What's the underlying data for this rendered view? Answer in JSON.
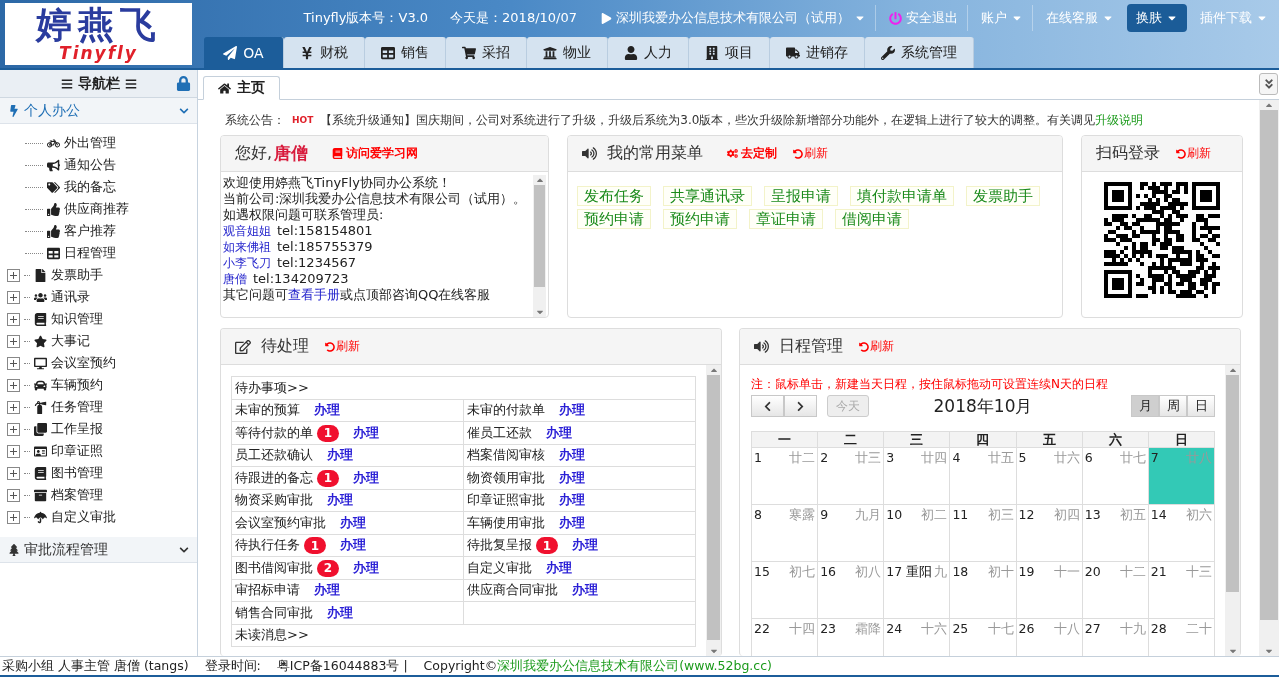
{
  "header": {
    "logo": {
      "title": "婷燕飞",
      "subtitle": "Tinyfly"
    },
    "version": "Tinyfly版本号：V3.0",
    "today": "今天是：2018/10/07",
    "company": "深圳我爱办公信息技术有限公司（试用）",
    "logout": "安全退出",
    "menus": [
      {
        "label": "账户",
        "selected": false
      },
      {
        "label": "在线客服",
        "selected": false
      },
      {
        "label": "换肤",
        "selected": true
      },
      {
        "label": "插件下载",
        "selected": false
      }
    ],
    "module_tabs": [
      {
        "label": "OA",
        "selected": true
      },
      {
        "label": "财税",
        "selected": false
      },
      {
        "label": "销售",
        "selected": false
      },
      {
        "label": "采招",
        "selected": false
      },
      {
        "label": "物业",
        "selected": false
      },
      {
        "label": "人力",
        "selected": false
      },
      {
        "label": "项目",
        "selected": false
      },
      {
        "label": "进销存",
        "selected": false
      },
      {
        "label": "系统管理",
        "selected": false
      }
    ]
  },
  "sidebar": {
    "title": "导航栏",
    "sections": [
      {
        "label": "个人办公",
        "expanded": true,
        "items": [
          {
            "label": "外出管理",
            "kind": "leaf"
          },
          {
            "label": "通知公告",
            "kind": "leaf"
          },
          {
            "label": "我的备忘",
            "kind": "leaf"
          },
          {
            "label": "供应商推荐",
            "kind": "leaf"
          },
          {
            "label": "客户推荐",
            "kind": "leaf"
          },
          {
            "label": "日程管理",
            "kind": "leaf"
          },
          {
            "label": "发票助手",
            "kind": "folder"
          },
          {
            "label": "通讯录",
            "kind": "folder"
          },
          {
            "label": "知识管理",
            "kind": "folder"
          },
          {
            "label": "大事记",
            "kind": "folder"
          },
          {
            "label": "会议室预约",
            "kind": "folder"
          },
          {
            "label": "车辆预约",
            "kind": "folder"
          },
          {
            "label": "任务管理",
            "kind": "folder"
          },
          {
            "label": "工作呈报",
            "kind": "folder"
          },
          {
            "label": "印章证照",
            "kind": "folder"
          },
          {
            "label": "图书管理",
            "kind": "folder"
          },
          {
            "label": "档案管理",
            "kind": "folder"
          },
          {
            "label": "自定义审批",
            "kind": "folder"
          }
        ]
      },
      {
        "label": "审批流程管理",
        "expanded": false
      }
    ]
  },
  "page_tabs": [
    {
      "label": "主页",
      "selected": true
    }
  ],
  "notice": {
    "label": "系统公告：",
    "badge": "HOT",
    "text": "【系统升级通知】国庆期间，公司对系统进行了升级，升级后系统为3.0版本，些次升级除新增部分功能外，在逻辑上进行了较大的调整。有关调见",
    "link": "升级说明"
  },
  "welcome": {
    "greeting": "您好,",
    "name": "唐僧",
    "link": "访问爱学习网",
    "lines": [
      "欢迎使用婷燕飞TinyFly协同办公系统！",
      "当前公司:深圳我爱办公信息技术有限公司（试用）。",
      "如遇权限问题可联系管理员:"
    ],
    "contacts": [
      {
        "name": "观音姐姐",
        "tel": "tel:158154801"
      },
      {
        "name": "如来佛祖",
        "tel": "tel:185755379"
      },
      {
        "name": "小李飞刀",
        "tel": "tel:1234567"
      },
      {
        "name": "唐僧",
        "tel": "tel:134209723"
      }
    ],
    "help": {
      "before": "其它问题可",
      "link": "查看手册",
      "after": "或点顶部咨询QQ在线客服"
    }
  },
  "menu_card": {
    "title": "我的常用菜单",
    "customize": "去定制",
    "refresh": "刷新",
    "items": [
      "发布任务",
      "共享通讯录",
      "呈报申请",
      "填付款申请单",
      "发票助手",
      "预约申请",
      "预约申请",
      "章证申请",
      "借阅申请"
    ]
  },
  "qr_card": {
    "title": "扫码登录",
    "refresh": "刷新"
  },
  "pending": {
    "title": "待处理",
    "refresh": "刷新",
    "sections": [
      {
        "title": "待办事项>>",
        "rows": [
          [
            {
              "label": "未审的预算",
              "action": "办理"
            },
            {
              "label": "未审的付款单",
              "action": "办理"
            }
          ],
          [
            {
              "label": "等待付款的单",
              "count": "1",
              "action": "办理"
            },
            {
              "label": "催员工还款",
              "action": "办理"
            }
          ],
          [
            {
              "label": "员工还款确认",
              "action": "办理"
            },
            {
              "label": "档案借阅审核",
              "action": "办理"
            }
          ],
          [
            {
              "label": "待跟进的备忘",
              "count": "1",
              "action": "办理"
            },
            {
              "label": "物资领用审批",
              "action": "办理"
            }
          ],
          [
            {
              "label": "物资采购审批",
              "action": "办理"
            },
            {
              "label": "印章证照审批",
              "action": "办理"
            }
          ],
          [
            {
              "label": "会议室预约审批",
              "action": "办理"
            },
            {
              "label": "车辆使用审批",
              "action": "办理"
            }
          ],
          [
            {
              "label": "待执行任务",
              "count": "1",
              "action": "办理"
            },
            {
              "label": "待批复呈报",
              "count": "1",
              "action": "办理"
            }
          ],
          [
            {
              "label": "图书借阅审批",
              "count": "2",
              "action": "办理"
            },
            {
              "label": "自定义审批",
              "action": "办理"
            }
          ],
          [
            {
              "label": "审招标申请",
              "action": "办理"
            },
            {
              "label": "供应商合同审批",
              "action": "办理"
            }
          ],
          [
            {
              "label": "销售合同审批",
              "action": "办理"
            },
            null
          ]
        ]
      },
      {
        "title": "未读消息>>"
      }
    ]
  },
  "schedule": {
    "title": "日程管理",
    "refresh": "刷新",
    "note": "注：鼠标单击，新建当天日程，按住鼠标拖动可设置连续N天的日程",
    "today_button": {
      "label": "今天",
      "disabled": true
    },
    "month": "2018年10月",
    "views": [
      {
        "label": "月",
        "selected": true
      },
      {
        "label": "周",
        "selected": false
      },
      {
        "label": "日",
        "selected": false
      }
    ],
    "weekdays": [
      "一",
      "二",
      "三",
      "四",
      "五",
      "六",
      "日"
    ],
    "weeks": [
      [
        {
          "day": "1",
          "lunar": "廿二",
          "today": false
        },
        {
          "day": "2",
          "lunar": "廿三",
          "today": false
        },
        {
          "day": "3",
          "lunar": "廿四",
          "today": false
        },
        {
          "day": "4",
          "lunar": "廿五",
          "today": false
        },
        {
          "day": "5",
          "lunar": "廿六",
          "today": false
        },
        {
          "day": "6",
          "lunar": "廿七",
          "today": false
        },
        {
          "day": "7",
          "lunar": "廿八",
          "today": true
        }
      ],
      [
        {
          "day": "8",
          "lunar": "寒露",
          "today": false
        },
        {
          "day": "9",
          "lunar": "九月",
          "today": false
        },
        {
          "day": "10",
          "lunar": "初二",
          "today": false
        },
        {
          "day": "11",
          "lunar": "初三",
          "today": false
        },
        {
          "day": "12",
          "lunar": "初四",
          "today": false
        },
        {
          "day": "13",
          "lunar": "初五",
          "today": false
        },
        {
          "day": "14",
          "lunar": "初六",
          "today": false
        }
      ],
      [
        {
          "day": "15",
          "lunar": "初七",
          "today": false
        },
        {
          "day": "16",
          "lunar": "初八",
          "today": false
        },
        {
          "day": "17",
          "festival": "重阳",
          "lunar": "九",
          "today": false
        },
        {
          "day": "18",
          "lunar": "初十",
          "today": false
        },
        {
          "day": "19",
          "lunar": "十一",
          "today": false
        },
        {
          "day": "20",
          "lunar": "十二",
          "today": false
        },
        {
          "day": "21",
          "lunar": "十三",
          "today": false
        }
      ],
      [
        {
          "day": "22",
          "lunar": "十四",
          "today": false
        },
        {
          "day": "23",
          "lunar": "霜降",
          "today": false
        },
        {
          "day": "24",
          "lunar": "十六",
          "today": false
        },
        {
          "day": "25",
          "lunar": "十七",
          "today": false
        },
        {
          "day": "26",
          "lunar": "十八",
          "today": false
        },
        {
          "day": "27",
          "lunar": "十九",
          "today": false
        },
        {
          "day": "28",
          "lunar": "二十",
          "today": false
        }
      ]
    ]
  },
  "footer": {
    "user": "采购小组 人事主管 唐僧 (tangs)",
    "login": "登录时间:",
    "icp": "粤ICP备16044883号 |",
    "copyright": "Copyright©",
    "link": "深圳我爱办公信息技术有限公司(www.52bg.cc)"
  }
}
